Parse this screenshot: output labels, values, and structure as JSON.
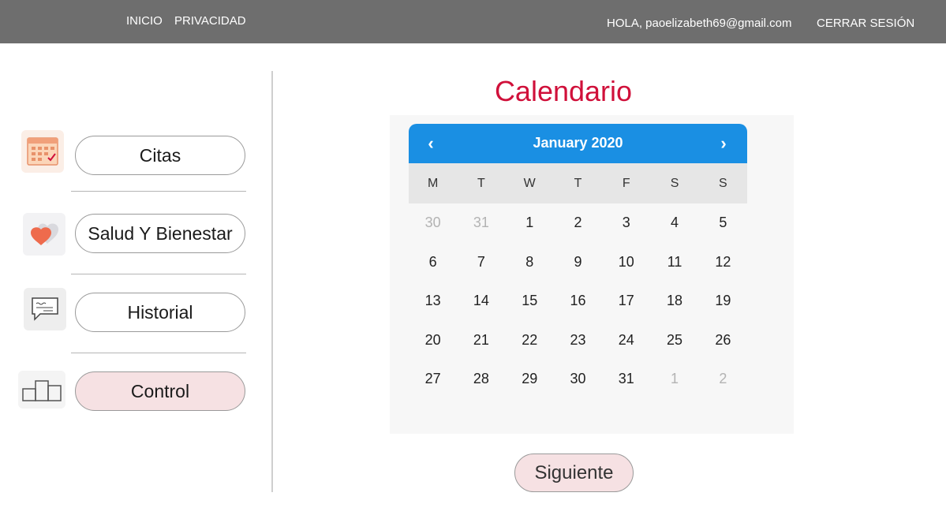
{
  "nav": {
    "home": "INICIO",
    "privacy": "PRIVACIDAD",
    "greeting": "HOLA, paoelizabeth69@gmail.com",
    "logout": "CERRAR SESIÓN"
  },
  "sidebar": {
    "items": [
      {
        "label": "Citas",
        "icon": "calendar-icon"
      },
      {
        "label": "Salud Y Bienestar",
        "icon": "heart-icon"
      },
      {
        "label": "Historial",
        "icon": "message-icon"
      },
      {
        "label": "Control",
        "icon": "podium-icon"
      }
    ]
  },
  "calendar": {
    "title": "Calendario",
    "month_label": "January 2020",
    "prev_label": "‹",
    "next_label": "›",
    "weekdays": [
      "M",
      "T",
      "W",
      "T",
      "F",
      "S",
      "S"
    ],
    "days": [
      {
        "n": "30",
        "muted": true
      },
      {
        "n": "31",
        "muted": true
      },
      {
        "n": "1"
      },
      {
        "n": "2"
      },
      {
        "n": "3"
      },
      {
        "n": "4"
      },
      {
        "n": "5"
      },
      {
        "n": "6"
      },
      {
        "n": "7"
      },
      {
        "n": "8"
      },
      {
        "n": "9"
      },
      {
        "n": "10"
      },
      {
        "n": "11"
      },
      {
        "n": "12"
      },
      {
        "n": "13"
      },
      {
        "n": "14"
      },
      {
        "n": "15"
      },
      {
        "n": "16"
      },
      {
        "n": "17"
      },
      {
        "n": "18"
      },
      {
        "n": "19"
      },
      {
        "n": "20"
      },
      {
        "n": "21"
      },
      {
        "n": "22"
      },
      {
        "n": "23"
      },
      {
        "n": "24"
      },
      {
        "n": "25"
      },
      {
        "n": "26"
      },
      {
        "n": "27"
      },
      {
        "n": "28"
      },
      {
        "n": "29"
      },
      {
        "n": "30"
      },
      {
        "n": "31"
      },
      {
        "n": "1",
        "muted": true
      },
      {
        "n": "2",
        "muted": true
      }
    ]
  },
  "actions": {
    "next_button": "Siguiente"
  },
  "colors": {
    "topbar": "#6e6e6e",
    "title": "#d0103a",
    "calendar_header": "#1a8fe3",
    "active_button": "#f6e1e3"
  }
}
